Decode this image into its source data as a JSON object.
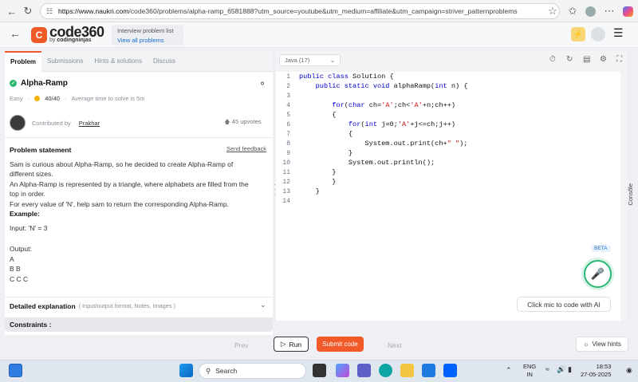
{
  "browser": {
    "url_host": "https://www.naukri.com",
    "url_path": "/code360/problems/alpha-ramp_6581888?utm_source=youtube&utm_medium=affiliate&utm_campaign=striver_patternproblems"
  },
  "header": {
    "logo_text": "code360",
    "logo_sub_by": "by",
    "logo_sub_brand": "codingninjas",
    "interview_list_title": "Interview problem list",
    "interview_list_link": "View all problems"
  },
  "tabs": [
    "Problem",
    "Submissions",
    "Hints & solutions",
    "Discuss"
  ],
  "problem": {
    "title": "Alpha-Ramp",
    "difficulty": "Easy",
    "points": "40/40",
    "avg_time": "Average time to solve is 5m",
    "contributed_by": "Contributed by",
    "contributor": "Prakhar",
    "upvotes": "45 upvotes",
    "statement_heading": "Problem statement",
    "send_feedback": "Send feedback",
    "statement_lines": [
      "Sam is curious about Alpha-Ramp, so he decided to create Alpha-Ramp of",
      "different sizes.",
      "An Alpha-Ramp is represented by a triangle, where alphabets are filled from the",
      "top in order.",
      "For every value of 'N', help sam to return the corresponding Alpha-Ramp."
    ],
    "example_heading": "Example:",
    "example_input": "Input: 'N' = 3",
    "example_output_label": "Output:",
    "example_output_lines": [
      "A",
      "B B",
      "C C C"
    ],
    "detailed_heading": "Detailed explanation",
    "detailed_sub": "( Input/output format, Notes, Images )",
    "constraints_heading": "Constraints :"
  },
  "editor": {
    "language": "Java (17)",
    "line_numbers": [
      "1",
      "2",
      "3",
      "4",
      "5",
      "6",
      "7",
      "8",
      "9",
      "10",
      "11",
      "12",
      "13",
      "14"
    ],
    "console_label": "Console",
    "beta_label": "BETA",
    "mic_prompt": "Click mic to code with AI"
  },
  "actions": {
    "prev": "Prev",
    "run": "Run",
    "submit": "Submit code",
    "next": "Next",
    "view_hints": "View hints"
  },
  "taskbar": {
    "search_placeholder": "Search",
    "lang_top": "ENG",
    "lang_bottom": "IN",
    "time": "18:53",
    "date": "27-05-2025"
  },
  "colors": {
    "brand": "#f05a28",
    "success": "#2bb673",
    "link": "#1a6fd1"
  }
}
